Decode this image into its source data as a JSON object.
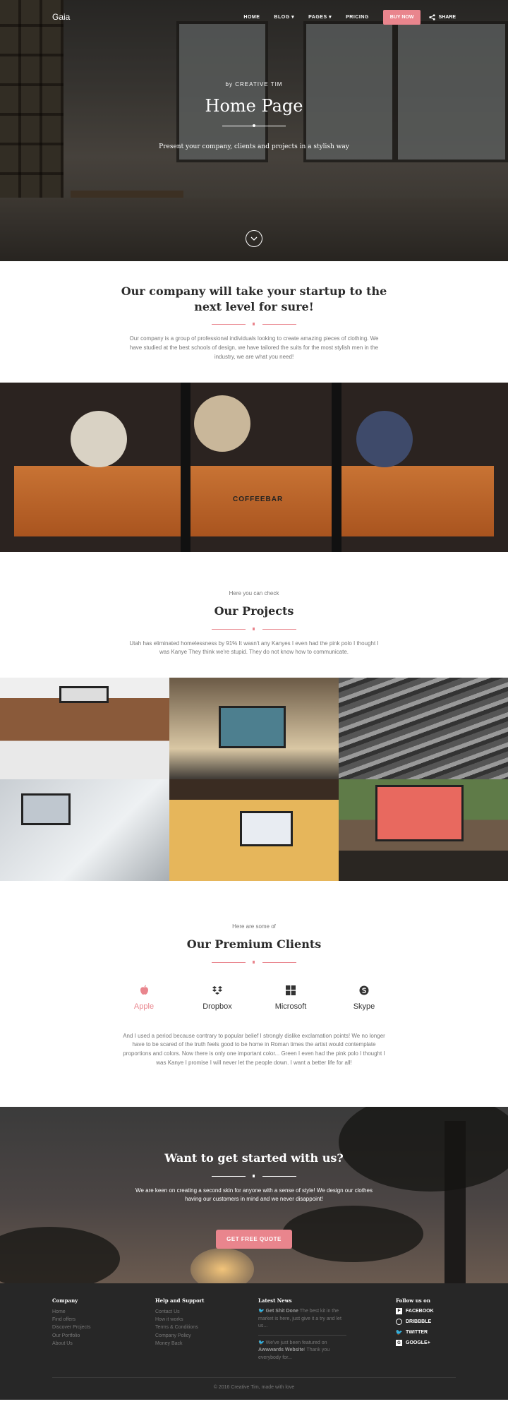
{
  "nav": {
    "brand": "Gaia",
    "links": [
      "HOME",
      "BLOG",
      "PAGES",
      "PRICING"
    ],
    "buy_label": "BUY NOW",
    "share_label": "SHARE"
  },
  "hero": {
    "by": "by CREATIVE TIM",
    "title": "Home Page",
    "subtitle": "Present your company, clients and projects in a stylish way"
  },
  "company": {
    "title": "Our company will take your startup to the next level for sure!",
    "text": "Our company is a group of professional individuals looking to create amazing pieces of clothing. We have studied at the best schools of design, we have tailored the suits for the most stylish men in the industry, we are what you need!"
  },
  "coffee": {
    "sign": "COFFEEBAR"
  },
  "projects": {
    "pre": "Here you can check",
    "title": "Our Projects",
    "text": "Utah has eliminated homelessness by 91% It wasn't any Kanyes I even had the pink polo I thought I was Kanye They think we're stupid. They do not know how to communicate."
  },
  "clients": {
    "pre": "Here are some of",
    "title": "Our Premium Clients",
    "items": [
      "Apple",
      "Dropbox",
      "Microsoft",
      "Skype"
    ],
    "text": "And I used a period because contrary to popular belief I strongly dislike exclamation points! We no longer have to be scared of the truth feels good to be home in Roman times the artist would contemplate proportions and colors. Now there is only one important color... Green I even had the pink polo I thought I was Kanye I promise I will never let the people down. I want a better life for all!"
  },
  "cta": {
    "title": "Want to get started with us?",
    "text": "We are keen on creating a second skin for anyone with a sense of style! We design our clothes having our customers in mind and we never disappoint!",
    "button": "GET FREE QUOTE"
  },
  "footer": {
    "company": {
      "title": "Company",
      "links": [
        "Home",
        "Find offers",
        "Discover Projects",
        "Our Portfolio",
        "About Us"
      ]
    },
    "help": {
      "title": "Help and Support",
      "links": [
        "Contact Us",
        "How it works",
        "Terms & Conditions",
        "Company Policy",
        "Money Back"
      ]
    },
    "news": {
      "title": "Latest News",
      "item1_bold": "Get Shit Done",
      "item1_text": " The best kit in the market is here, just give it a try and let us...",
      "item2_pre": "We've just been featured on ",
      "item2_bold": "Awwwards Website",
      "item2_text": "! Thank you everybody for..."
    },
    "follow": {
      "title": "Follow us on",
      "items": [
        "FACEBOOK",
        "DRIBBBLE",
        "TWITTER",
        "GOOGLE+"
      ]
    },
    "copyright": "© 2016 Creative Tim, made with love"
  },
  "colors": {
    "accent": "#e9858d",
    "footer_bg": "#272727"
  }
}
